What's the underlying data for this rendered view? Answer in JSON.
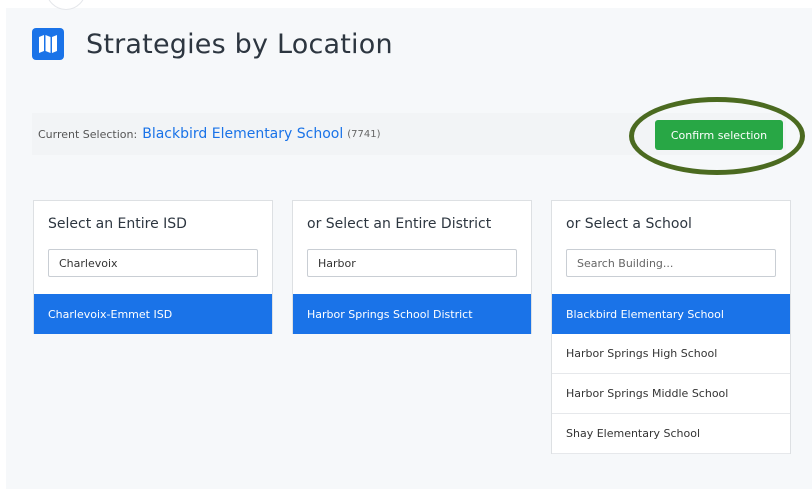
{
  "header": {
    "title": "Strategies by Location",
    "title_icon": "map-icon"
  },
  "selection": {
    "prefix": "Current Selection:",
    "name": "Blackbird Elementary School",
    "code": "(7741)",
    "confirm_label": "Confirm selection"
  },
  "panels": {
    "isd": {
      "title": "Select an Entire ISD",
      "search_value": "Charlevoix",
      "search_placeholder": "",
      "items": [
        {
          "label": "Charlevoix-Emmet ISD",
          "active": true
        }
      ]
    },
    "district": {
      "title": "or Select an Entire District",
      "search_value": "Harbor",
      "search_placeholder": "",
      "items": [
        {
          "label": "Harbor Springs School District",
          "active": true
        }
      ]
    },
    "school": {
      "title": "or Select a School",
      "search_value": "",
      "search_placeholder": "Search Building...",
      "items": [
        {
          "label": "Blackbird Elementary School",
          "active": true
        },
        {
          "label": "Harbor Springs High School",
          "active": false
        },
        {
          "label": "Harbor Springs Middle School",
          "active": false
        },
        {
          "label": "Shay Elementary School",
          "active": false
        }
      ]
    }
  },
  "colors": {
    "accent": "#1a73e8",
    "confirm": "#28a745",
    "highlight_ring": "#4b6a20"
  }
}
